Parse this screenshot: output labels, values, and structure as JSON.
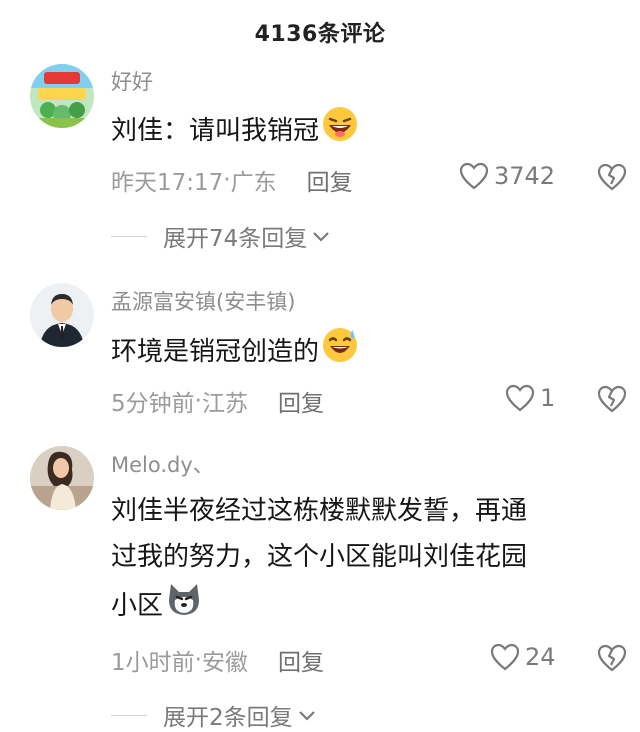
{
  "header": {
    "title": "4136条评论"
  },
  "comments": [
    {
      "username": "好好",
      "content": "刘佳：请叫我销冠",
      "emoji": "laughing-face-emoji",
      "time": "昨天17:17",
      "location": "广东",
      "reply_label": "回复",
      "likes": "3742",
      "expand_label": "展开74条回复"
    },
    {
      "username": "孟源富安镇(安丰镇)",
      "content": "环境是销冠创造的",
      "emoji": "sweat-smile-emoji",
      "time": "5分钟前",
      "location": "江苏",
      "reply_label": "回复",
      "likes": "1"
    },
    {
      "username": "Melo.dy、",
      "content_line1": "刘佳半夜经过这栋楼默默发誓，再通",
      "content_line2": "过我的努力，这个小区能叫刘佳花园",
      "content_line3": "小区",
      "emoji": "husky-dog-emoji",
      "time": "1小时前",
      "location": "安徽",
      "reply_label": "回复",
      "likes": "24",
      "expand_label": "展开2条回复"
    }
  ],
  "colors": {
    "text": "#161616",
    "meta": "#9b9b9b",
    "like_icon": "#7a7a7a"
  },
  "separator": " · "
}
